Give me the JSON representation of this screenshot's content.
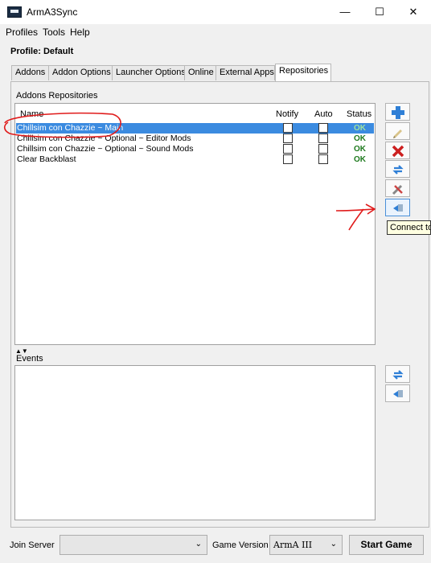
{
  "window": {
    "title": "ArmA3Sync",
    "minimize_glyph": "—",
    "maximize_glyph": "☐",
    "close_glyph": "✕"
  },
  "menubar": {
    "items": [
      "Profiles",
      "Tools",
      "Help"
    ]
  },
  "profile_label": "Profile: Default",
  "tabs": [
    "Addons",
    "Addon Options",
    "Launcher Options",
    "Online",
    "External Apps",
    "Repositories"
  ],
  "active_tab": "Repositories",
  "repositories": {
    "section_label": "Addons Repositories",
    "columns": {
      "name": "Name",
      "notify": "Notify",
      "auto": "Auto",
      "status": "Status"
    },
    "rows": [
      {
        "name": "Chillsim con Chazzie ~ Main",
        "status": "OK",
        "selected": true
      },
      {
        "name": "Chillsim con Chazzie ~ Optional ~ Editor Mods",
        "status": "OK",
        "selected": false
      },
      {
        "name": "Chillsim con Chazzie ~ Optional ~ Sound Mods",
        "status": "OK",
        "selected": false
      },
      {
        "name": "Clear Backblast",
        "status": "OK",
        "selected": false
      }
    ]
  },
  "side_buttons": [
    {
      "name": "add-repository-button",
      "icon": "plus-icon"
    },
    {
      "name": "edit-repository-button",
      "icon": "pencil-icon"
    },
    {
      "name": "remove-repository-button",
      "icon": "red-x-icon"
    },
    {
      "name": "sync-repository-button",
      "icon": "sync-arrows-icon"
    },
    {
      "name": "repository-tools-button",
      "icon": "tools-icon"
    },
    {
      "name": "connect-button",
      "icon": "connect-icon"
    }
  ],
  "tooltip": "Connect to",
  "events": {
    "section_label": "Events",
    "buttons": [
      {
        "name": "events-sync-button",
        "icon": "sync-arrows-icon"
      },
      {
        "name": "events-connect-button",
        "icon": "connect-icon"
      }
    ]
  },
  "footer": {
    "join_server_label": "Join Server",
    "join_server_value": "",
    "game_version_label": "Game Version",
    "game_version_value": "ArmA III",
    "start_game_label": "Start Game"
  },
  "colors": {
    "selection": "#3b8be0",
    "status_ok": "#1e7a1e",
    "annotation": "#e01b1b",
    "add_icon": "#2f7fd6",
    "remove_icon": "#cc1f1f"
  }
}
